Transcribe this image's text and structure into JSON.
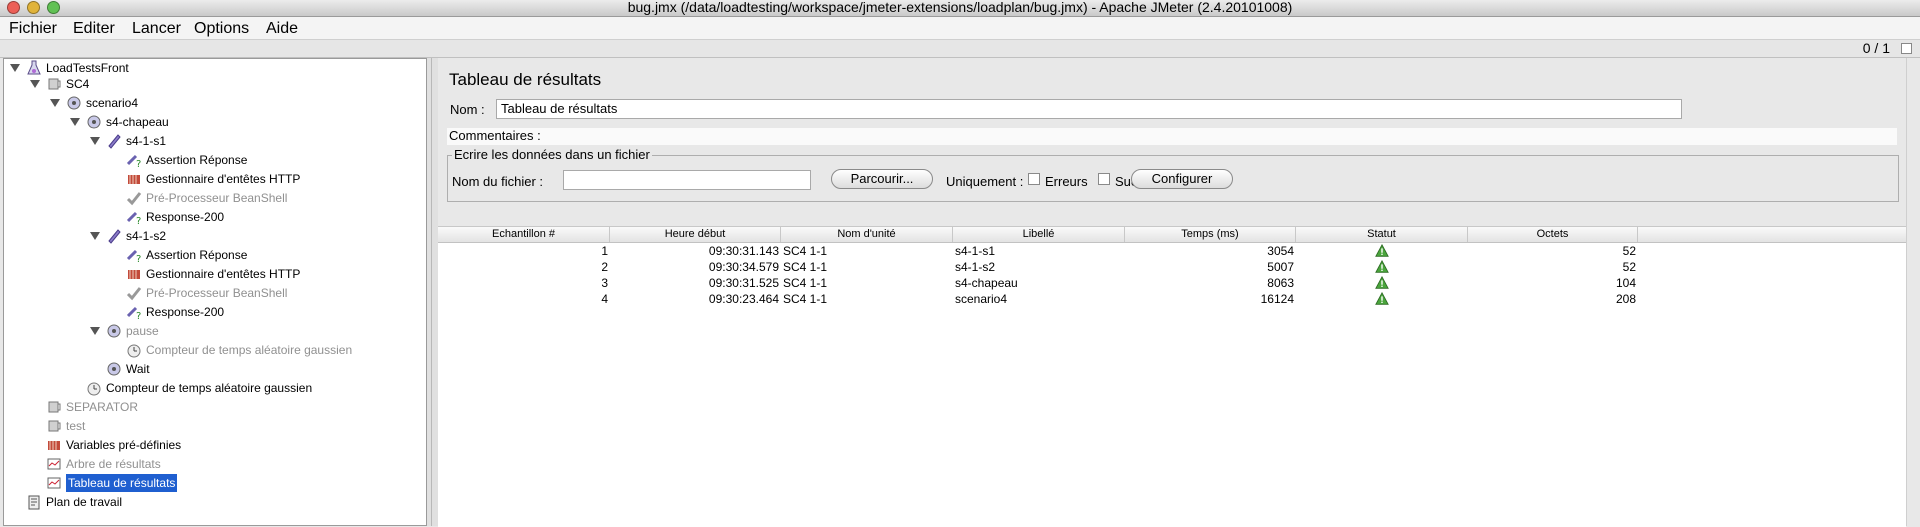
{
  "window": {
    "title": "bug.jmx (/data/loadtesting/workspace/jmeter-extensions/loadplan/bug.jmx) - Apache JMeter (2.4.20101008)",
    "controls": {
      "close_color": "#ec5f57",
      "minimize_color": "#e0b33a",
      "zoom_color": "#61c154"
    }
  },
  "menu": [
    "Fichier",
    "Editer",
    "Lancer",
    "Options",
    "Aide"
  ],
  "toolbar": {
    "counter": "0 / 1"
  },
  "tree": {
    "root": "LoadTestsFront",
    "items": [
      {
        "label": "SC4",
        "icon": "thread-group-icon",
        "dim": false
      },
      {
        "label": "scenario4",
        "icon": "controller-icon",
        "dim": false
      },
      {
        "label": "s4-chapeau",
        "icon": "controller-icon",
        "dim": false
      },
      {
        "label": "s4-1-s1",
        "icon": "sampler-icon",
        "dim": false
      },
      {
        "label": "Assertion Réponse",
        "icon": "assertion-icon",
        "dim": false
      },
      {
        "label": "Gestionnaire d'entêtes HTTP",
        "icon": "config-element-icon",
        "dim": false
      },
      {
        "label": "Pré-Processeur BeanShell",
        "icon": "preprocessor-icon",
        "dim": true
      },
      {
        "label": "Response-200",
        "icon": "assertion-icon",
        "dim": false
      },
      {
        "label": "s4-1-s2",
        "icon": "sampler-icon",
        "dim": false
      },
      {
        "label": "Assertion Réponse",
        "icon": "assertion-icon",
        "dim": false
      },
      {
        "label": "Gestionnaire d'entêtes HTTP",
        "icon": "config-element-icon",
        "dim": false
      },
      {
        "label": "Pré-Processeur BeanShell",
        "icon": "preprocessor-icon",
        "dim": true
      },
      {
        "label": "Response-200",
        "icon": "assertion-icon",
        "dim": false
      },
      {
        "label": "pause",
        "icon": "controller-icon",
        "dim": true
      },
      {
        "label": "Compteur de temps aléatoire gaussien",
        "icon": "timer-icon",
        "dim": true
      },
      {
        "label": "Wait",
        "icon": "controller-icon",
        "dim": false
      },
      {
        "label": "Compteur de temps aléatoire gaussien",
        "icon": "timer-icon",
        "dim": false
      },
      {
        "label": "SEPARATOR",
        "icon": "thread-group-icon",
        "dim": true
      },
      {
        "label": "test",
        "icon": "thread-group-icon",
        "dim": true
      },
      {
        "label": "Variables pré-définies",
        "icon": "config-element-icon",
        "dim": false
      },
      {
        "label": "Arbre de résultats",
        "icon": "listener-icon",
        "dim": true
      },
      {
        "label": "Tableau de résultats",
        "icon": "listener-icon",
        "dim": false,
        "selected": true
      },
      {
        "label": "Plan de travail",
        "icon": "workbench-icon",
        "dim": false
      }
    ]
  },
  "panel": {
    "title": "Tableau de résultats",
    "name_label": "Nom :",
    "name_value": "Tableau de résultats",
    "comments_label": "Commentaires :",
    "file_section_title": "Ecrire les données dans un fichier",
    "file_label": "Nom du fichier :",
    "file_value": "",
    "browse_label": "Parcourir...",
    "only_label": "Uniquement :",
    "errors_label": "Erreurs",
    "success_label": "Succès",
    "errors_checked": false,
    "success_checked": false,
    "configure_label": "Configurer"
  },
  "table": {
    "headers": [
      "Echantillon #",
      "Heure début",
      "Nom d'unité",
      "Libellé",
      "Temps (ms)",
      "Statut",
      "Octets"
    ],
    "rows": [
      {
        "sample": "1",
        "start": "09:30:31.143",
        "thread": "SC4 1-1",
        "label": "s4-1-s1",
        "time": "3054",
        "status": "success",
        "bytes": "52"
      },
      {
        "sample": "2",
        "start": "09:30:34.579",
        "thread": "SC4 1-1",
        "label": "s4-1-s2",
        "time": "5007",
        "status": "success",
        "bytes": "52"
      },
      {
        "sample": "3",
        "start": "09:30:31.525",
        "thread": "SC4 1-1",
        "label": "s4-chapeau",
        "time": "8063",
        "status": "success",
        "bytes": "104"
      },
      {
        "sample": "4",
        "start": "09:30:23.464",
        "thread": "SC4 1-1",
        "label": "scenario4",
        "time": "16124",
        "status": "success",
        "bytes": "208"
      }
    ]
  },
  "colors": {
    "selection": "#1f5fd0",
    "success_icon": "#4aa53c"
  }
}
